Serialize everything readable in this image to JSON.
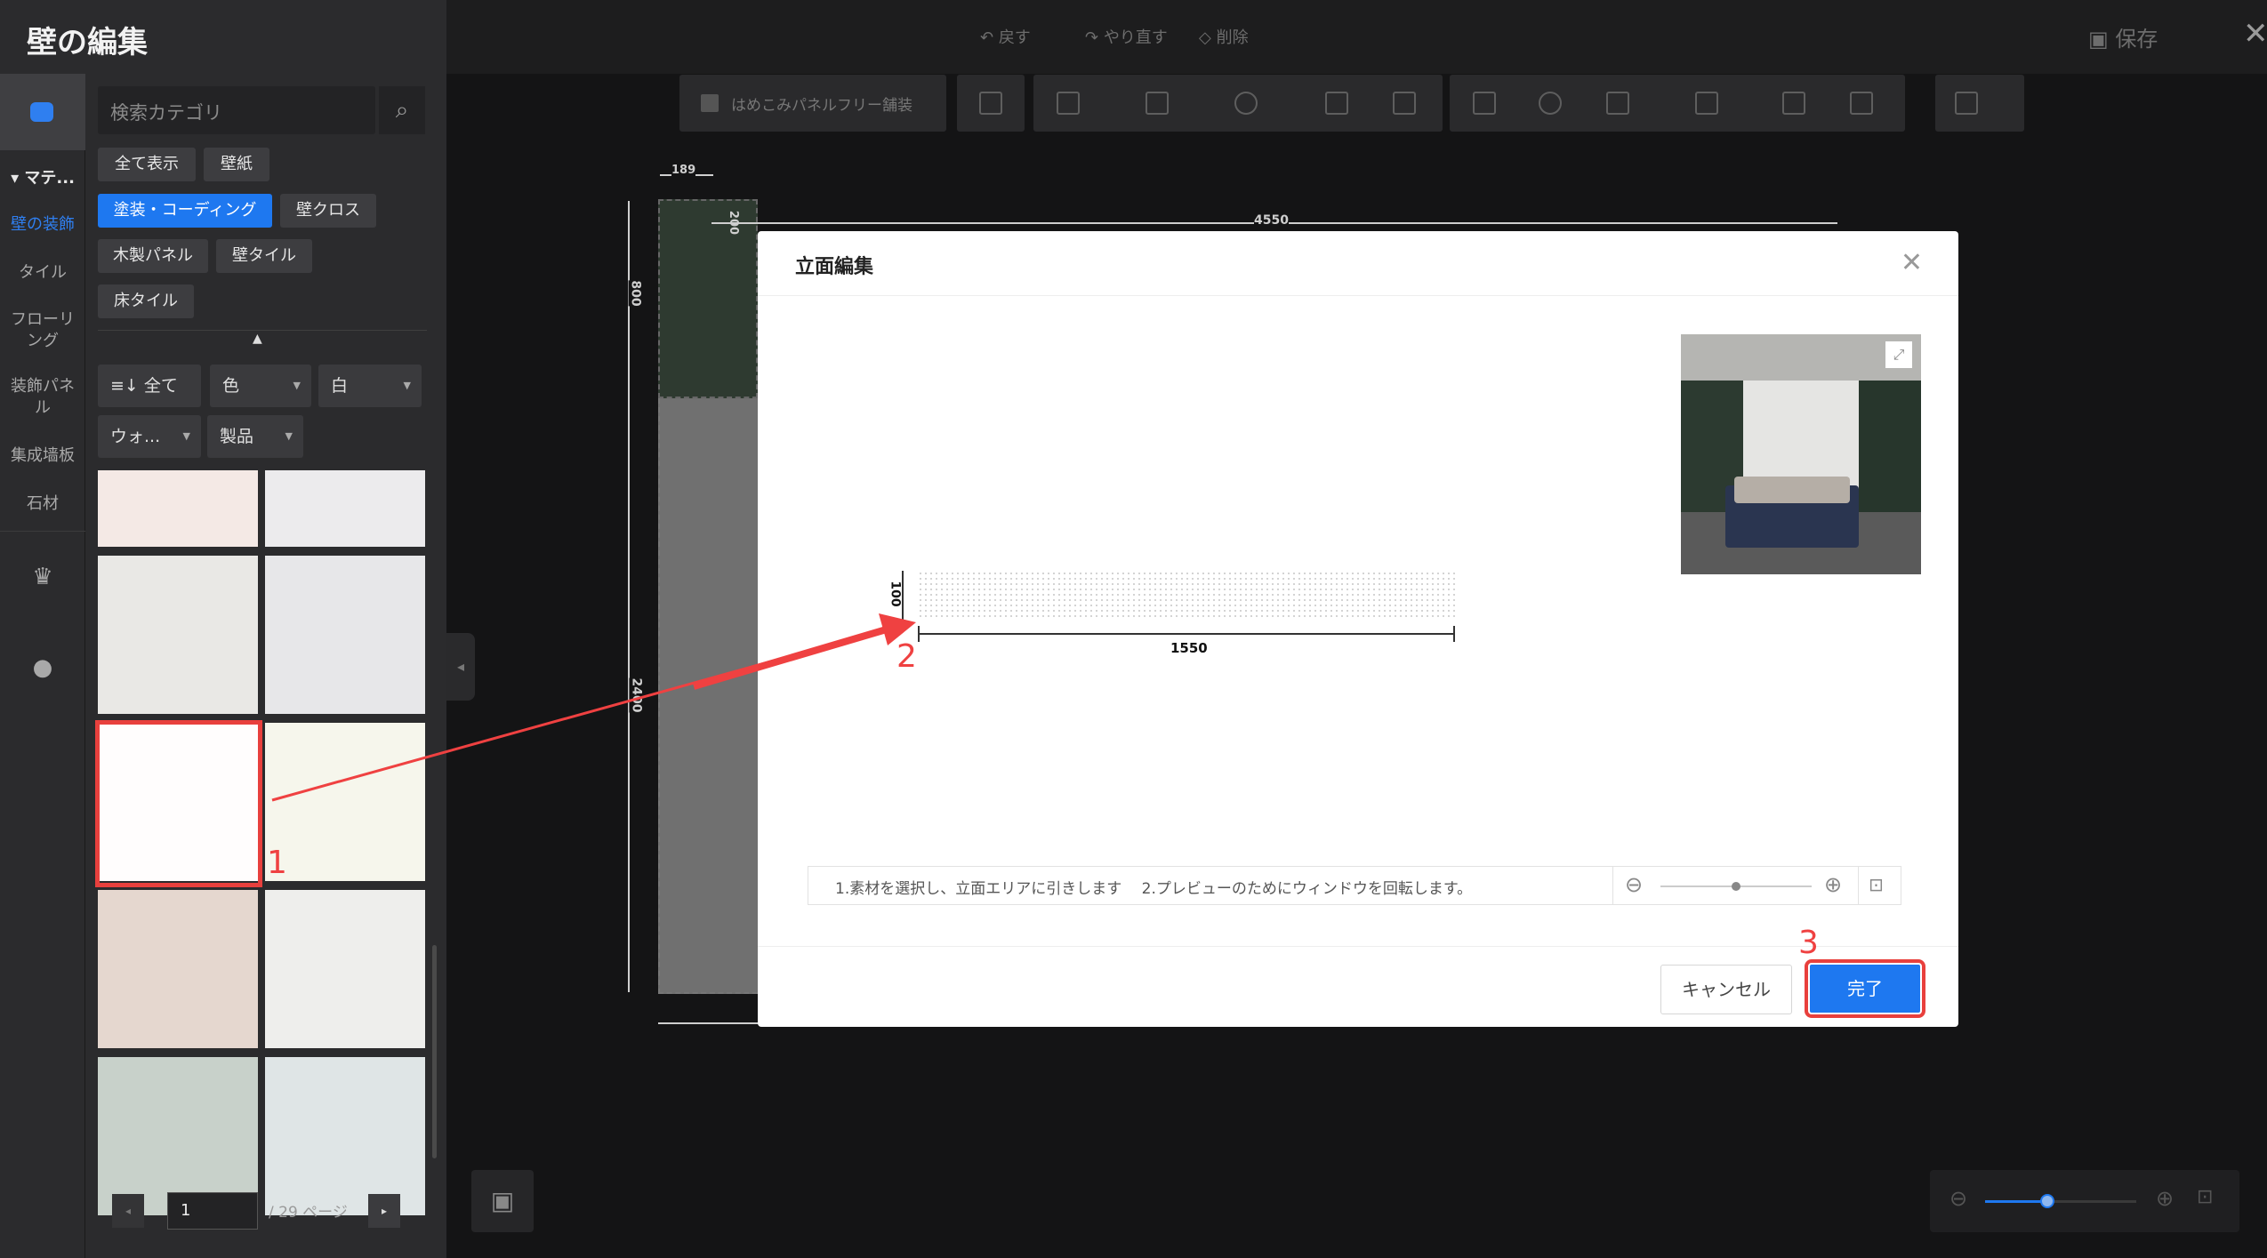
{
  "title": "壁の編集",
  "toolbar": {
    "undo": "戻す",
    "redo": "やり直す",
    "delete": "削除",
    "save": "保存"
  },
  "canvas_toolbar": {
    "checkbox_label": "はめこみパネルフリー舗装"
  },
  "search": {
    "placeholder": "検索カテゴリ"
  },
  "rail": {
    "section": "マテ...",
    "items": [
      "壁の装飾",
      "タイル",
      "フローリング",
      "装飾パネル",
      "集成墙板",
      "石材"
    ]
  },
  "category_chips": [
    "全て表示",
    "壁紙",
    "塗装・コーディング",
    "壁クロス",
    "木製パネル",
    "壁タイル",
    "床タイル"
  ],
  "filters": {
    "all": "全て",
    "color": "色",
    "white": "白",
    "type": "ウォ...",
    "product": "製品"
  },
  "swatch_colors": [
    "#f4e9e5",
    "#ecebed",
    "#e9e8e5",
    "#e7e7e9",
    "#fffdfd",
    "#f6f6ec",
    "#e5d7cf",
    "#eeeeec",
    "#c8d1ca",
    "#dfe5e6"
  ],
  "pagination": {
    "page": "1",
    "total": "/ 29 ページ"
  },
  "dimensions": {
    "d189": "189",
    "d4550": "4550",
    "d800": "800",
    "d200": "200",
    "d2400": "2400"
  },
  "modal": {
    "title": "立面編集",
    "width_dim": "1550",
    "height_dim": "100",
    "hint": "1.素材を選択し、立面エリアに引きします　 2.プレビューのためにウィンドウを回転します。",
    "cancel": "キャンセル",
    "done": "完了"
  },
  "annotations": {
    "n1": "1",
    "n2": "2",
    "n3": "3"
  },
  "accent_color": "#1e78f0",
  "annotation_color": "#ef4141"
}
